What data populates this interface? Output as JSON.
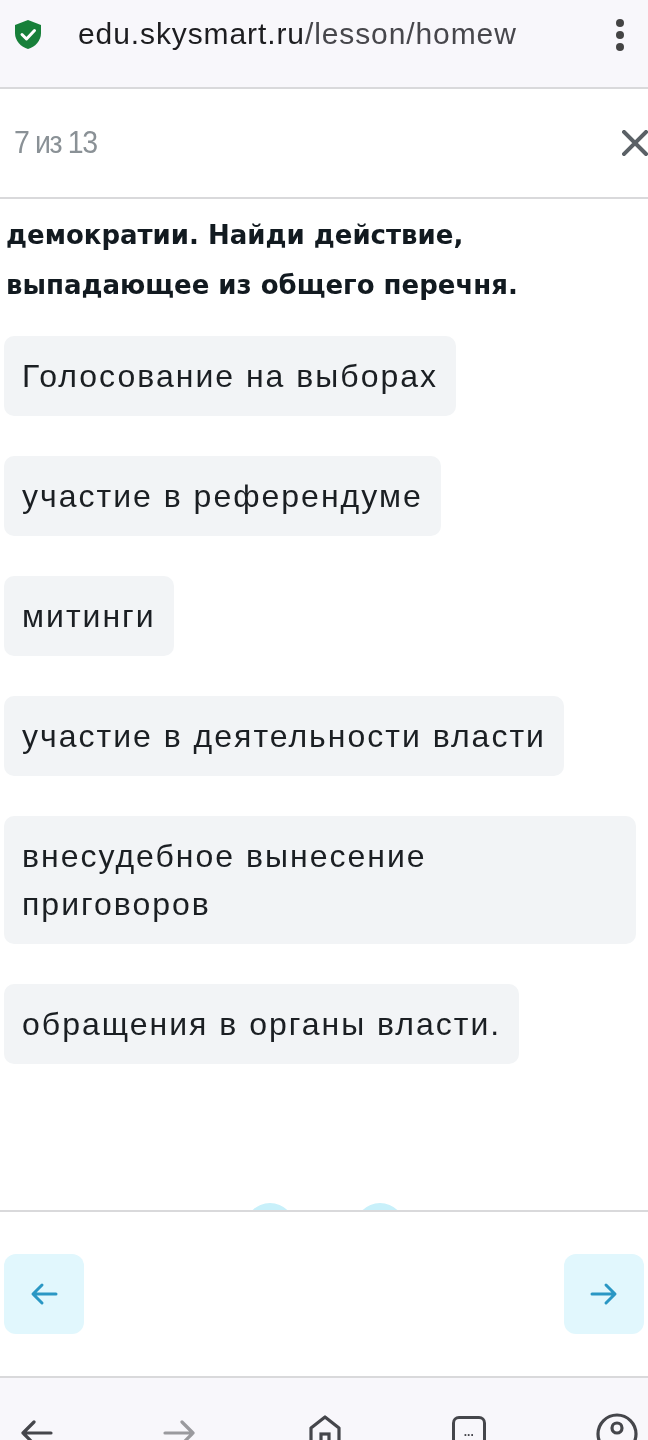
{
  "browser": {
    "secure": true,
    "domain": "edu.skysmart.ru",
    "path": "/lesson/homew"
  },
  "header": {
    "progress": "7 из 13"
  },
  "question": {
    "text": "демократии. Найди действие, выпадающее из общего перечня."
  },
  "options": [
    {
      "label": "Голосование на выборах",
      "selected": false
    },
    {
      "label": "участие в референдуме",
      "selected": false
    },
    {
      "label": "митинги",
      "selected": false
    },
    {
      "label": "участие в деятельности власти",
      "selected": false
    },
    {
      "label": "внесудебное вынесение приговоров",
      "selected": false
    },
    {
      "label": "обращения в органы власти.",
      "selected": false
    }
  ],
  "footer": {
    "buttons": [
      {
        "kind": "prev"
      },
      {
        "kind": "next"
      }
    ]
  },
  "nav": [
    {
      "kind": "back",
      "disabled": false
    },
    {
      "kind": "forward",
      "disabled": true
    },
    {
      "kind": "home"
    },
    {
      "kind": "tabs",
      "count": "..."
    },
    {
      "kind": "account"
    }
  ]
}
